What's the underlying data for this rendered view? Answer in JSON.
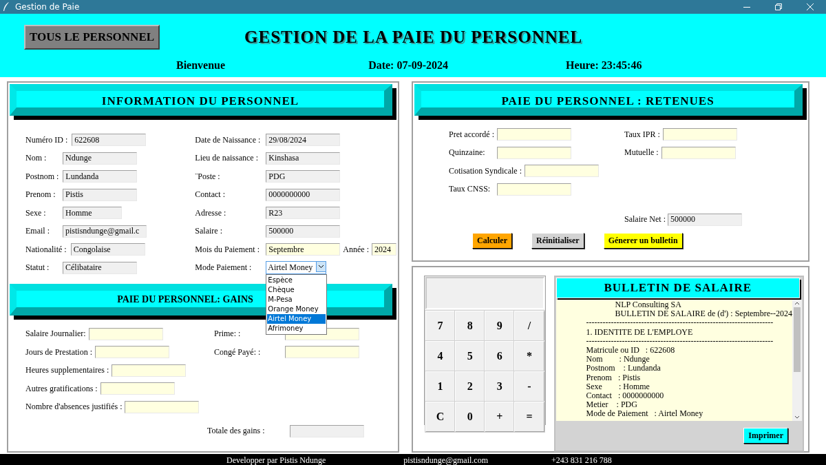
{
  "window": {
    "title": "Gestion de Paie"
  },
  "header": {
    "button": "TOUS LE PERSONNEL",
    "title": "GESTION DE LA PAIE DU PERSONNEL",
    "welcome": "Bienvenue",
    "date": "Date: 07-09-2024",
    "time": "Heure: 23:45:46"
  },
  "info": {
    "title": "INFORMATION DU PERSONNEL",
    "left": [
      {
        "label": "Numéro ID :",
        "value": "622608",
        "kind": "readonly"
      },
      {
        "label": "Nom :",
        "value": "Ndunge",
        "kind": "readonly"
      },
      {
        "label": "Postnom :",
        "value": "Lundanda",
        "kind": "readonly"
      },
      {
        "label": "Prenom :",
        "value": "Pistis",
        "kind": "readonly"
      },
      {
        "label": "Sexe :",
        "value": "Homme",
        "kind": "readonly"
      },
      {
        "label": "Email :",
        "value": "pistisndunge@gmail.c",
        "kind": "readonly"
      },
      {
        "label": "Nationalité :",
        "value": "Congolaise",
        "kind": "readonly"
      },
      {
        "label": "Statut :",
        "value": "Célibataire",
        "kind": "readonly"
      }
    ],
    "right": [
      {
        "label": "Date de Naissance :",
        "value": "29/08/2024",
        "kind": "readonly"
      },
      {
        "label": "Lieu de naissance :",
        "value": "Kinshasa",
        "kind": "readonly"
      },
      {
        "label": "¨Poste :",
        "value": "PDG",
        "kind": "readonly"
      },
      {
        "label": "Contact :",
        "value": "0000000000",
        "kind": "readonly"
      },
      {
        "label": "Adresse :",
        "value": "R23",
        "kind": "readonly"
      },
      {
        "label": "Salaire :",
        "value": "500000",
        "kind": "readonly"
      },
      {
        "label": "Mois du Paiement :",
        "value": "Septembre",
        "kind": "entry",
        "extra": {
          "label": "Année :",
          "value": "2024"
        }
      },
      {
        "label": "Mode Paiement :",
        "value": "Airtel Money",
        "kind": "combo",
        "expanded": true,
        "options": [
          {
            "label": "Espèce",
            "selected": false
          },
          {
            "label": "Chèque",
            "selected": false
          },
          {
            "label": "M-Pesa",
            "selected": false
          },
          {
            "label": "Orange Money",
            "selected": false
          },
          {
            "label": "Airtel Money",
            "selected": true
          },
          {
            "label": "Afrimoney",
            "selected": false
          }
        ]
      }
    ]
  },
  "gains": {
    "title": "PAIE DU PERSONNEL: GAINS",
    "left": [
      {
        "label": "Salaire Journalier:",
        "kind": "entry"
      },
      {
        "label": "Jours de Prestation :",
        "kind": "entry"
      },
      {
        "label": "Heures supplementaires :",
        "kind": "entry"
      },
      {
        "label": "Autres gratifications :",
        "kind": "entry"
      },
      {
        "label": "Nombre d'absences justifiés :",
        "kind": "entry"
      }
    ],
    "right": [
      {
        "label": "Prime: :",
        "kind": "entry"
      },
      {
        "label": "Congé Payé: :",
        "kind": "entry"
      }
    ],
    "total": {
      "label": "Totale des gains :",
      "kind": "readonly"
    }
  },
  "retenues": {
    "title": "PAIE DU PERSONNEL : RETENUES",
    "left": [
      {
        "label": "Pret accordé :",
        "kind": "entry"
      },
      {
        "label": "Quinzaine:",
        "kind": "entry"
      },
      {
        "label": "Cotisation Syndicale :",
        "kind": "entry"
      },
      {
        "label": "Taux CNSS:",
        "kind": "entry"
      }
    ],
    "right": [
      {
        "label": "Taux IPR :",
        "kind": "entry"
      },
      {
        "label": "Mutuelle :",
        "kind": "entry"
      }
    ],
    "net": {
      "label": "Salaire Net :",
      "value": "500000",
      "kind": "readonly"
    },
    "buttons": [
      {
        "label": "Calculer",
        "color": "#ffa500"
      },
      {
        "label": "Réinitialiser",
        "color": "#d3d3d3"
      },
      {
        "label": "Génerer un bulletin",
        "color": "#ffff00"
      }
    ]
  },
  "calculator": {
    "keys": [
      "7",
      "8",
      "9",
      "/",
      "4",
      "5",
      "6",
      "*",
      "1",
      "2",
      "3",
      "-",
      "C",
      "0",
      "+",
      "="
    ]
  },
  "bulletin": {
    "title": "BULLETIN DE SALAIRE",
    "button": "Imprimer",
    "lines": [
      {
        "text": "NLP Consulting SA",
        "kind": "title"
      },
      {
        "text": "BULLETIN DE SALAIRE de (d') : Septembre--2024",
        "kind": "title"
      },
      {
        "text": "--------------------------------------------------------------------",
        "kind": "body"
      },
      {
        "text": "1. IDENTITE DE L'EMPLOYE",
        "kind": "body"
      },
      {
        "text": "--------------------------------------------------------------------",
        "kind": "body"
      },
      {
        "text": "Matricule ou ID   : 622608",
        "kind": "body"
      },
      {
        "text": "Nom        : Ndunge",
        "kind": "body"
      },
      {
        "text": "Postnom    : Lundanda",
        "kind": "body"
      },
      {
        "text": "Prenom   : Pistis",
        "kind": "body"
      },
      {
        "text": "Sexe        : Homme",
        "kind": "body"
      },
      {
        "text": "Contact   : 0000000000",
        "kind": "body"
      },
      {
        "text": "Metier    : PDG",
        "kind": "body"
      },
      {
        "text": "Mode de Paiement   : Airtel Money",
        "kind": "body"
      }
    ]
  },
  "footer": {
    "author": "Developper par Pistis Ndunge",
    "email": "pistisndunge@gmail.com",
    "phone": "+243 831 216 788"
  }
}
